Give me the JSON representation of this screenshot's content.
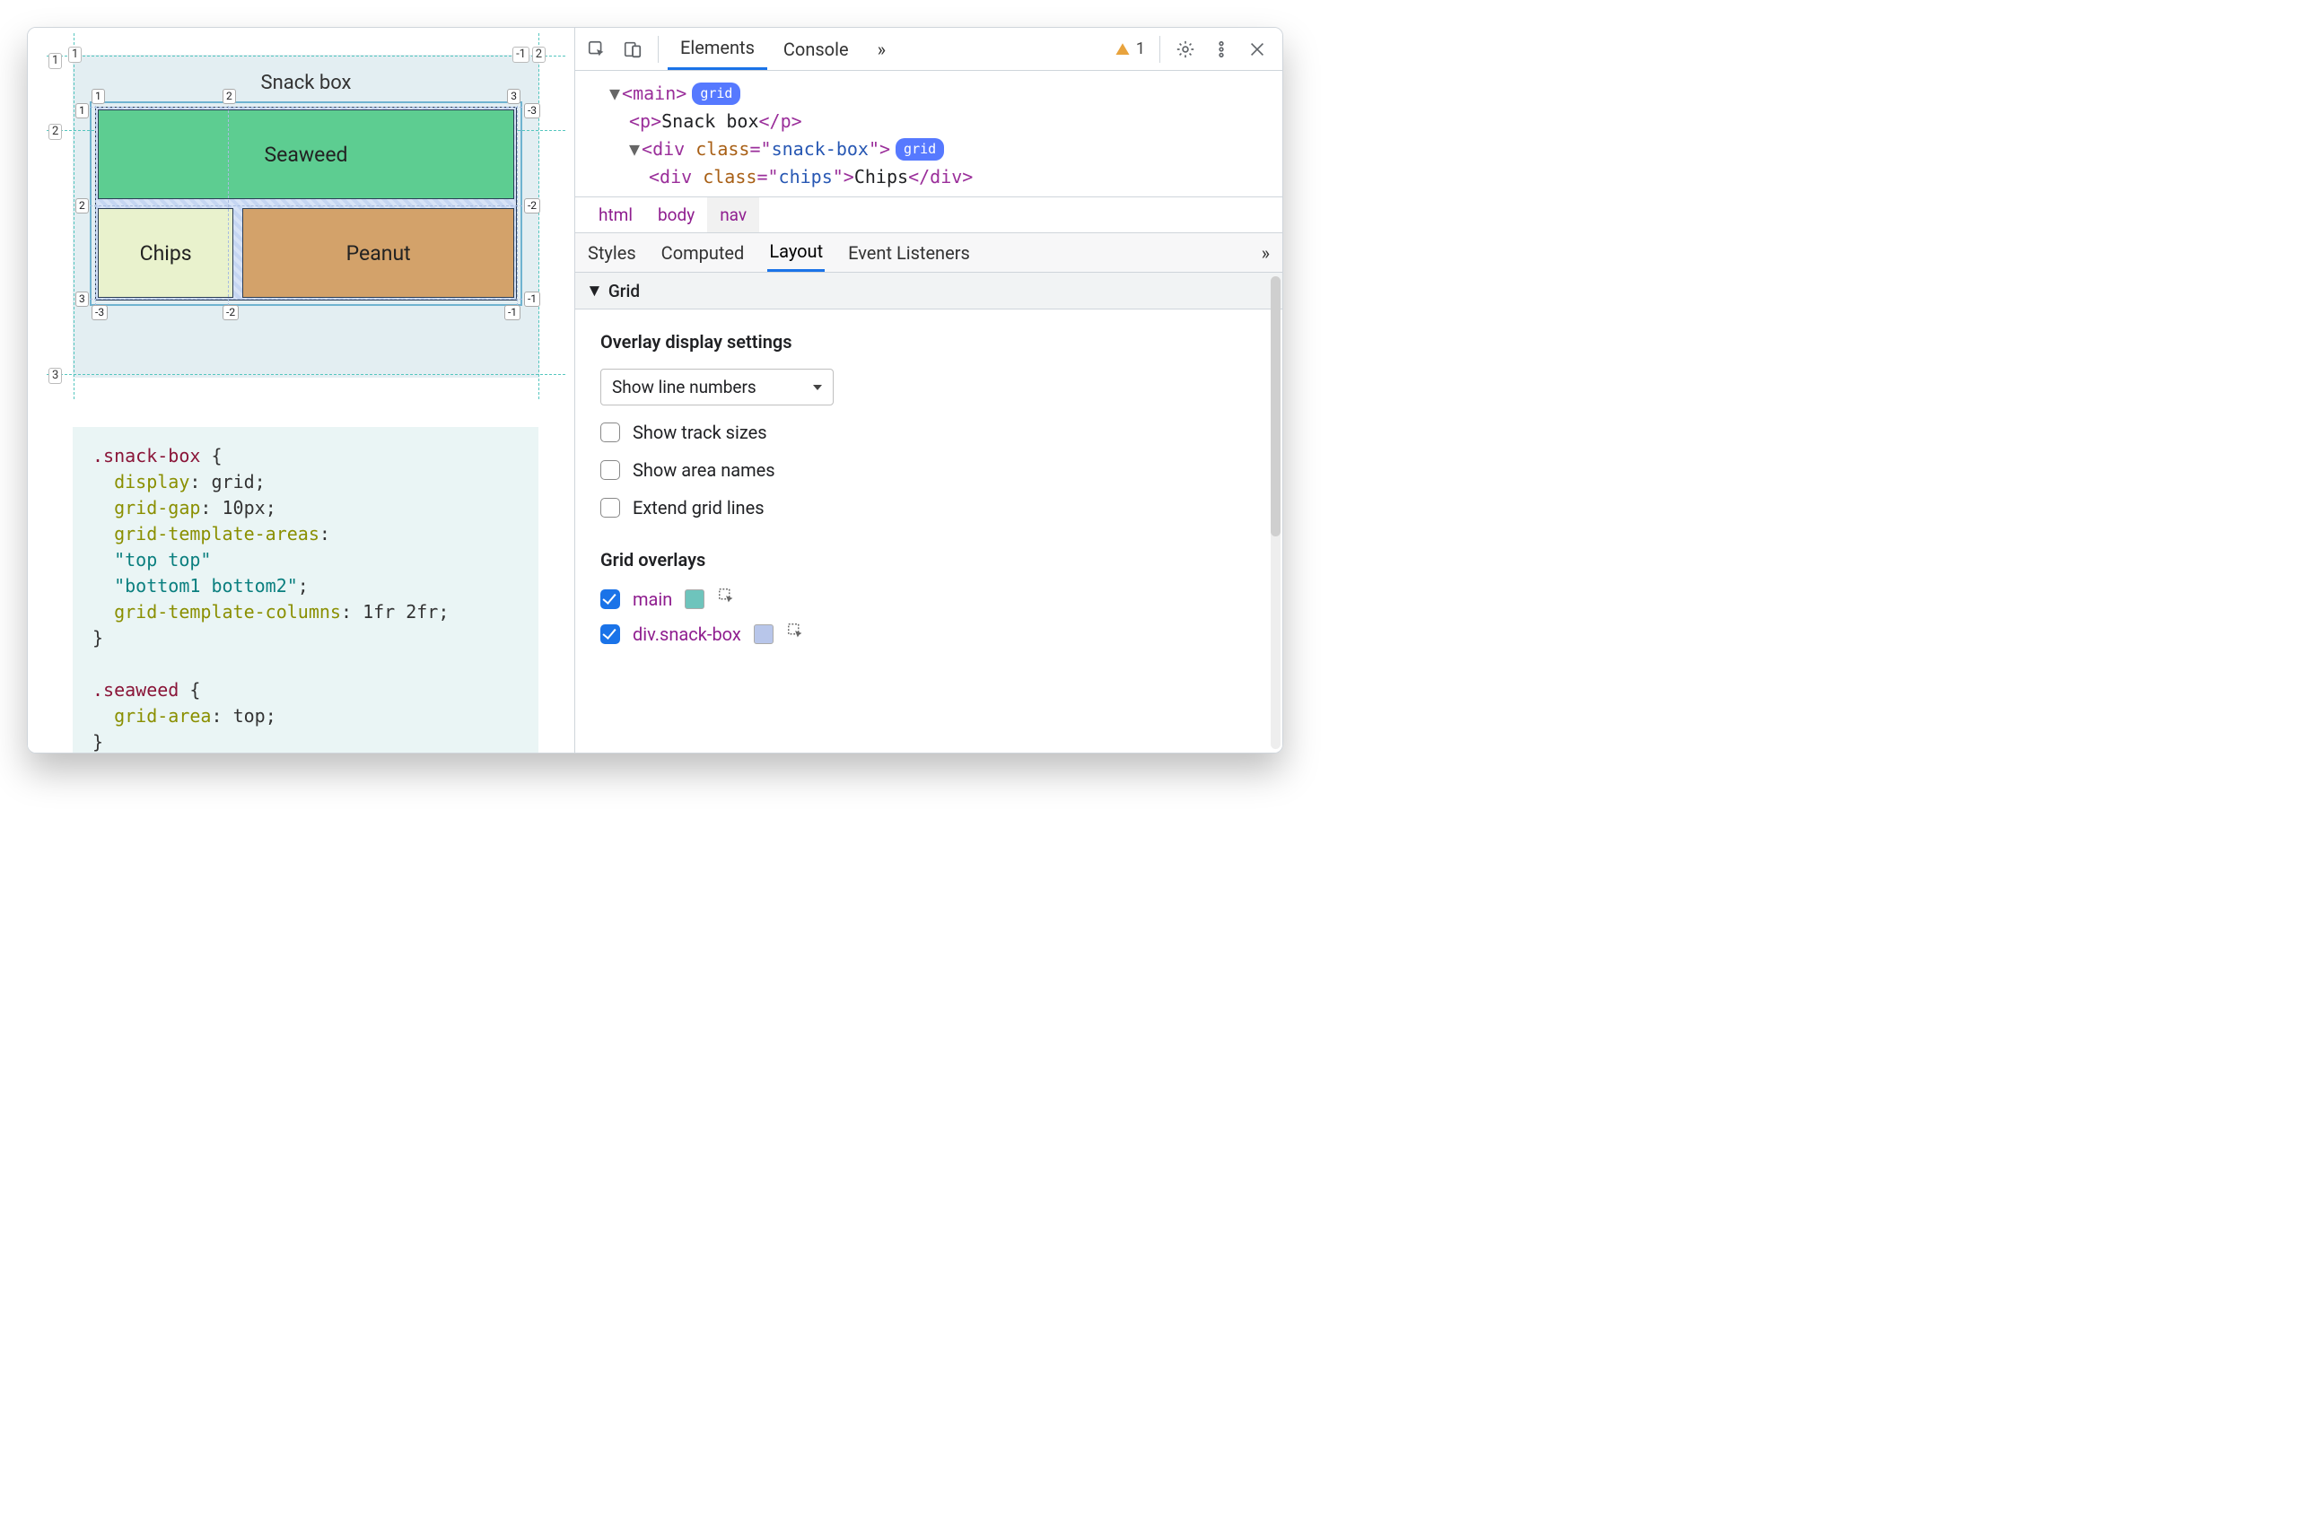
{
  "viewport": {
    "title": "Snack box",
    "boxes": {
      "seaweed": "Seaweed",
      "chips": "Chips",
      "peanut": "Peanut"
    },
    "outer_row_labels": [
      "1",
      "2",
      "3"
    ],
    "outer_col_labels_pos": [
      "1",
      "2"
    ],
    "outer_col_labels_neg": [
      "-1"
    ],
    "inner": {
      "top_cols": [
        "1",
        "2",
        "3"
      ],
      "right_rows_neg": [
        "-3",
        "-2",
        "-1"
      ],
      "left_rows": [
        "1",
        "2",
        "3"
      ],
      "bottom_cols_neg": [
        "-3",
        "-2",
        "-1"
      ]
    },
    "code": {
      "sel1": ".snack-box",
      "lines1": [
        {
          "prop": "display",
          "val": "grid",
          "type": "v"
        },
        {
          "prop": "grid-gap",
          "val": "10px",
          "type": "v"
        },
        {
          "prop": "grid-template-areas",
          "val": "",
          "type": "head"
        },
        {
          "str": "\"top top\"",
          "type": "s"
        },
        {
          "str": "\"bottom1 bottom2\"",
          "tail": ";",
          "type": "s"
        },
        {
          "prop": "grid-template-columns",
          "val": "1fr 2fr",
          "type": "v"
        }
      ],
      "sel2": ".seaweed",
      "lines2": [
        {
          "prop": "grid-area",
          "val": "top",
          "type": "v"
        }
      ]
    }
  },
  "devtools": {
    "tabs": [
      "Elements",
      "Console"
    ],
    "more": "»",
    "warn_count": "1",
    "breadcrumb": [
      "html",
      "body",
      "nav"
    ],
    "subtabs": [
      "Styles",
      "Computed",
      "Layout",
      "Event Listeners"
    ],
    "subtab_more": "»",
    "dom": {
      "l1_tag": "main",
      "l1_badge": "grid",
      "l2_text": "Snack box",
      "l2_tag": "p",
      "l3_tag": "div",
      "l3_class": "snack-box",
      "l3_badge": "grid",
      "l4_tag": "div",
      "l4_class": "chips",
      "l4_text": "Chips"
    },
    "layout": {
      "section": "Grid",
      "overlay_heading": "Overlay display settings",
      "select_label": "Show line numbers",
      "checkboxes": [
        {
          "label": "Show track sizes",
          "checked": false
        },
        {
          "label": "Show area names",
          "checked": false
        },
        {
          "label": "Extend grid lines",
          "checked": false
        }
      ],
      "overlays_heading": "Grid overlays",
      "overlays": [
        {
          "label": "main",
          "checked": true,
          "color": "#6ec4bc"
        },
        {
          "label": "div.snack-box",
          "checked": true,
          "color": "#b8c6ea"
        }
      ]
    }
  }
}
